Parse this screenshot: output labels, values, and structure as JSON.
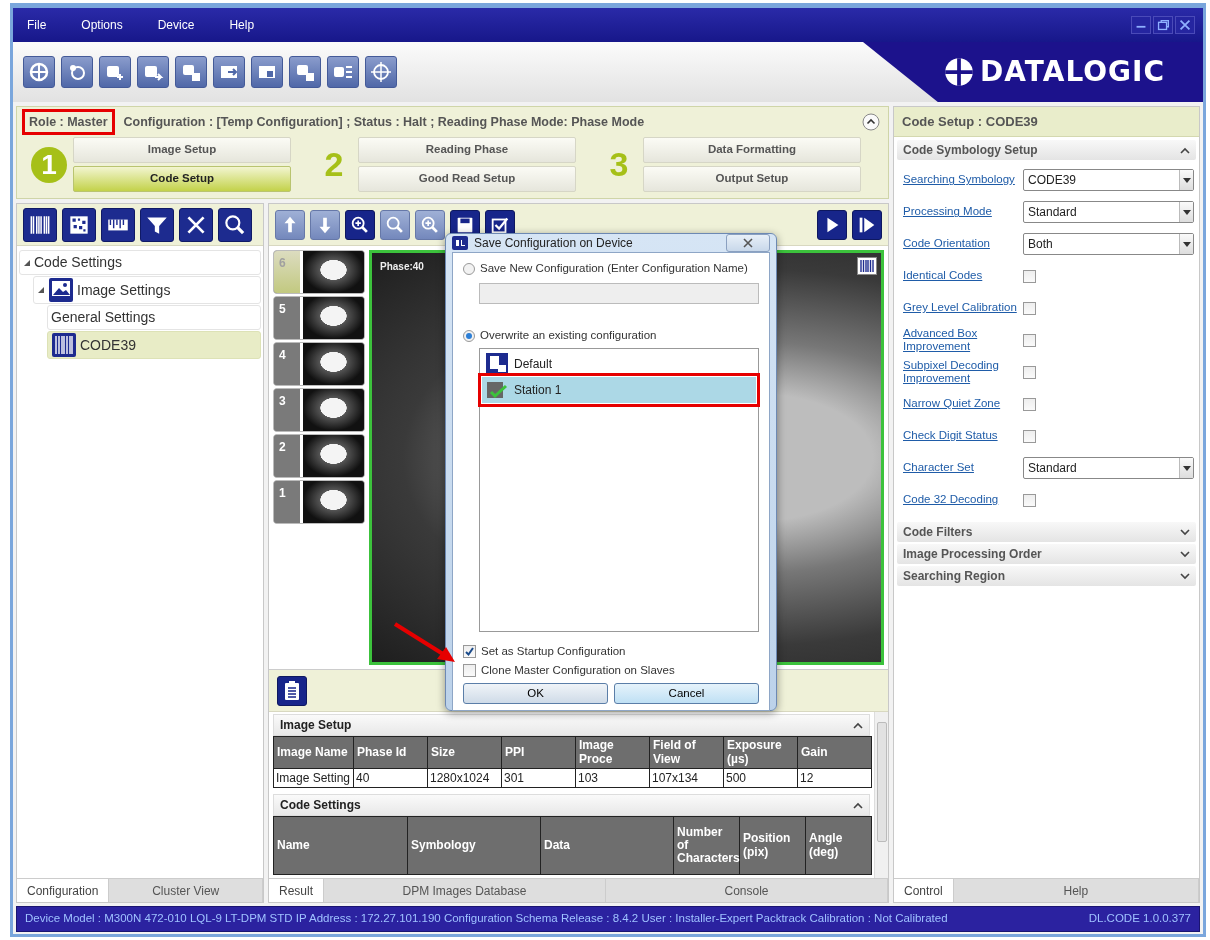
{
  "window": {
    "menu": [
      "File",
      "Options",
      "Device",
      "Help"
    ]
  },
  "logo": {
    "text": "DATALOGIC"
  },
  "header": {
    "role": "Role :  Master",
    "status": "Configuration :  [Temp Configuration] ;  Status :  Halt ;  Reading Phase Mode: Phase Mode"
  },
  "steps": [
    {
      "number": "1",
      "selected": true,
      "buttons": [
        {
          "label": "Image Setup",
          "selected": false
        },
        {
          "label": "Code Setup",
          "selected": true
        }
      ]
    },
    {
      "number": "2",
      "selected": false,
      "buttons": [
        {
          "label": "Reading Phase",
          "selected": false
        },
        {
          "label": "Good Read Setup",
          "selected": false
        }
      ]
    },
    {
      "number": "3",
      "selected": false,
      "buttons": [
        {
          "label": "Data Formatting",
          "selected": false
        },
        {
          "label": "Output Setup",
          "selected": false
        }
      ]
    }
  ],
  "tree": [
    {
      "label": "Code Settings",
      "expanded": true,
      "selected": false,
      "children": [
        {
          "label": "Image Settings",
          "kind": "image",
          "expanded": true,
          "selected": false,
          "children": [
            {
              "label": "General Settings",
              "selected": false
            },
            {
              "label": "CODE39",
              "kind": "barcode",
              "selected": true
            }
          ]
        }
      ]
    }
  ],
  "left_tabs": [
    {
      "label": "Configuration",
      "selected": true
    },
    {
      "label": "Cluster View",
      "selected": false
    }
  ],
  "thumbnails": [
    {
      "number": "6",
      "selected": true
    },
    {
      "number": "5",
      "selected": false
    },
    {
      "number": "4",
      "selected": false
    },
    {
      "number": "3",
      "selected": false
    },
    {
      "number": "2",
      "selected": false
    },
    {
      "number": "1",
      "selected": false
    }
  ],
  "image": {
    "label": "Phase:40"
  },
  "dialog": {
    "title": "Save Configuration on Device",
    "options": [
      {
        "label": "Save New Configuration (Enter Configuration Name)",
        "selected": false
      },
      {
        "label": "Overwrite an existing configuration",
        "selected": true
      }
    ],
    "configurations": [
      {
        "name": "Default",
        "kind": "default",
        "selected": false
      },
      {
        "name": "Station 1",
        "kind": "station",
        "selected": true
      }
    ],
    "checkboxes": [
      {
        "label": "Set as Startup Configuration",
        "checked": true
      },
      {
        "label": "Clone Master Configuration on Slaves",
        "checked": false
      }
    ],
    "buttons": [
      "OK",
      "Cancel"
    ]
  },
  "image_setup": {
    "title": "Image Setup",
    "columns": [
      "Image Name",
      "Phase Id",
      "Size",
      "PPI",
      "Image Proce",
      "Field of View",
      "Exposure (µs)",
      "Gain"
    ],
    "rows": [
      [
        "Image Setting",
        "40",
        "1280x1024",
        "301",
        "103",
        "107x134",
        "500",
        "12"
      ]
    ]
  },
  "code_settings": {
    "title": "Code Settings",
    "columns": [
      "Name",
      "Symbology",
      "Data",
      "Number of Characters",
      "Position (pix)",
      "Angle (deg)"
    ]
  },
  "bottom_tabs": [
    {
      "label": "Result",
      "selected": true
    },
    {
      "label": "DPM Images Database",
      "selected": false
    },
    {
      "label": "Console",
      "selected": false
    }
  ],
  "right_panel": {
    "title": "Code Setup :  CODE39",
    "sections": [
      {
        "title": "Code Symbology Setup",
        "expanded": true,
        "fields": [
          {
            "label": "Searching Symbology",
            "kind": "select",
            "value": "CODE39"
          },
          {
            "label": "Processing Mode",
            "kind": "select",
            "value": "Standard"
          },
          {
            "label": "Code Orientation",
            "kind": "select",
            "value": "Both"
          },
          {
            "label": "Identical Codes",
            "kind": "checkbox",
            "checked": false
          },
          {
            "label": "Grey Level Calibration",
            "kind": "checkbox",
            "checked": false
          },
          {
            "label": "Advanced Box Improvement",
            "kind": "checkbox",
            "checked": false
          },
          {
            "label": "Subpixel Decoding Improvement",
            "kind": "checkbox",
            "checked": false
          },
          {
            "label": "Narrow Quiet Zone",
            "kind": "checkbox",
            "checked": false
          },
          {
            "label": "Check Digit Status",
            "kind": "checkbox",
            "checked": false
          },
          {
            "label": "Character Set",
            "kind": "select",
            "value": "Standard"
          },
          {
            "label": "Code 32 Decoding",
            "kind": "checkbox",
            "checked": false
          }
        ]
      },
      {
        "title": "Code Filters",
        "expanded": false
      },
      {
        "title": "Image Processing Order",
        "expanded": false
      },
      {
        "title": "Searching Region",
        "expanded": false
      }
    ]
  },
  "right_tabs": [
    {
      "label": "Control",
      "selected": true
    },
    {
      "label": "Help",
      "selected": false
    }
  ],
  "status_bar": {
    "info": "Device Model : M300N  472-010  LQL-9 LT-DPM STD  IP Address :  172.27.101.190  Configuration Schema Release :  8.4.2  User : Installer-Expert  Packtrack Calibration : Not Calibrated",
    "version": "DL.CODE 1.0.0.377"
  }
}
